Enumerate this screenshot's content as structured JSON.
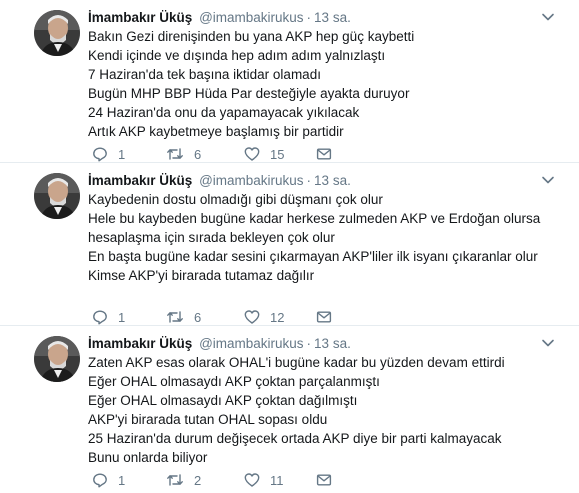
{
  "tweets": [
    {
      "name": "İmambakır Üküş",
      "handle": "@imambakirukus",
      "dot": "·",
      "time": "13 sa.",
      "lines": [
        "Bakın Gezi direnişinden bu yana AKP hep güç kaybetti",
        "Kendi içinde ve dışında hep adım adım yalnızlaştı",
        "7 Haziran'da tek başına iktidar olamadı",
        "Bugün MHP BBP Hüda Par desteğiyle ayakta duruyor",
        "24 Haziran'da onu da yapamayacak yıkılacak",
        "Artık AKP kaybetmeye başlamış bir partidir"
      ],
      "replies": "1",
      "retweets": "6",
      "likes": "15"
    },
    {
      "name": "İmambakır Üküş",
      "handle": "@imambakirukus",
      "dot": "·",
      "time": "13 sa.",
      "lines": [
        "Kaybedenin dostu olmadığı gibi düşmanı çok olur",
        "Hele bu kaybeden bugüne kadar herkese zulmeden AKP ve Erdoğan olursa",
        "hesaplaşma için sırada bekleyen çok olur",
        "En başta bugüne kadar sesini çıkarmayan AKP'liler ilk isyanı çıkaranlar olur",
        "Kimse AKP'yi birarada tutamaz dağılır"
      ],
      "replies": "1",
      "retweets": "6",
      "likes": "12"
    },
    {
      "name": "İmambakır Üküş",
      "handle": "@imambakirukus",
      "dot": "·",
      "time": "13 sa.",
      "lines": [
        "Zaten AKP esas olarak OHAL'i bugüne kadar bu yüzden devam ettirdi",
        "Eğer OHAL olmasaydı AKP çoktan parçalanmıştı",
        "Eğer OHAL olmasaydı AKP çoktan dağılmıştı",
        "AKP'yi birarada tutan OHAL sopası oldu",
        "25 Haziran'da durum değişecek ortada AKP diye bir parti kalmayacak",
        "Bunu onlarda biliyor"
      ],
      "replies": "1",
      "retweets": "2",
      "likes": "11"
    }
  ],
  "icons": {
    "reply": "reply-icon",
    "retweet": "retweet-icon",
    "like": "heart-icon",
    "dm": "envelope-icon",
    "caret": "chevron-down-icon",
    "avatar": "avatar"
  },
  "colors": {
    "text": "#14171a",
    "secondary": "#657786",
    "divider": "#e6ecf0",
    "avatar_bg": "#2b2b2b"
  }
}
